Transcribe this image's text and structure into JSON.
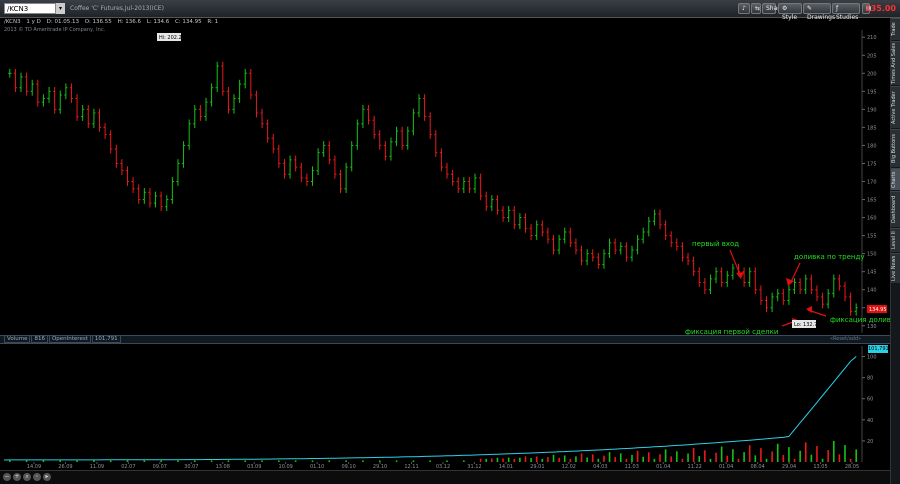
{
  "toolbar": {
    "symbol": "/KCN3",
    "contract_description": "Coffee 'C' Futures,Jul-2013(ICE)",
    "share_label": "Share",
    "style_label": "Style",
    "drawings_label": "Drawings",
    "studies_label": "Studies",
    "last_price": "135.00"
  },
  "infobar": {
    "symbol": "/KCN3",
    "agg": "1 y D",
    "date": "D: 01.05.13",
    "open": "O: 136.55",
    "high": "H: 136.6",
    "low": "L: 134.6",
    "close": "C: 134.95",
    "flag": "R: 1"
  },
  "copyright": "2013 © TD Ameritrade IP Company, Inc.",
  "right_tabs": [
    "Trade",
    "Times And Sales",
    "Active Trader",
    "Big Buttons",
    "Charts",
    "Dashboard",
    "Level II",
    "Live News"
  ],
  "volume_legend": {
    "volume": "Volume",
    "volume_value": "816",
    "open_interest": "OpenInterest",
    "oi_value": "101,791"
  },
  "expand_label": "«Reset/add»",
  "oi_badge": "101,791",
  "chart_data": {
    "type": "candlestick",
    "title": "",
    "price_axis": {
      "ylim": [
        128,
        212
      ],
      "ticks": [
        130,
        135,
        140,
        145,
        150,
        155,
        160,
        165,
        170,
        175,
        180,
        185,
        190,
        195,
        200,
        205,
        210
      ]
    },
    "price_points": [
      [
        0,
        200
      ],
      [
        1,
        196
      ],
      [
        2,
        199
      ],
      [
        3,
        195
      ],
      [
        4,
        197
      ],
      [
        5,
        192
      ],
      [
        6,
        193
      ],
      [
        7,
        195
      ],
      [
        8,
        190
      ],
      [
        9,
        194
      ],
      [
        10,
        196
      ],
      [
        11,
        193
      ],
      [
        12,
        188
      ],
      [
        13,
        190
      ],
      [
        14,
        186
      ],
      [
        15,
        189
      ],
      [
        16,
        185
      ],
      [
        17,
        183
      ],
      [
        18,
        179
      ],
      [
        19,
        175
      ],
      [
        20,
        173
      ],
      [
        21,
        170
      ],
      [
        22,
        168
      ],
      [
        23,
        165
      ],
      [
        24,
        167
      ],
      [
        25,
        164
      ],
      [
        26,
        166
      ],
      [
        27,
        163
      ],
      [
        28,
        165
      ],
      [
        29,
        170
      ],
      [
        30,
        175
      ],
      [
        31,
        180
      ],
      [
        32,
        186
      ],
      [
        33,
        190
      ],
      [
        34,
        188
      ],
      [
        35,
        192
      ],
      [
        36,
        196
      ],
      [
        37,
        202
      ],
      [
        38,
        195
      ],
      [
        39,
        190
      ],
      [
        40,
        193
      ],
      [
        41,
        197
      ],
      [
        42,
        200
      ],
      [
        43,
        194
      ],
      [
        44,
        189
      ],
      [
        45,
        186
      ],
      [
        46,
        182
      ],
      [
        47,
        179
      ],
      [
        48,
        175
      ],
      [
        49,
        172
      ],
      [
        50,
        176
      ],
      [
        51,
        174
      ],
      [
        52,
        171
      ],
      [
        53,
        170
      ],
      [
        54,
        173
      ],
      [
        55,
        178
      ],
      [
        56,
        180
      ],
      [
        57,
        176
      ],
      [
        58,
        172
      ],
      [
        59,
        168
      ],
      [
        60,
        174
      ],
      [
        61,
        180
      ],
      [
        62,
        186
      ],
      [
        63,
        190
      ],
      [
        64,
        187
      ],
      [
        65,
        183
      ],
      [
        66,
        180
      ],
      [
        67,
        177
      ],
      [
        68,
        181
      ],
      [
        69,
        184
      ],
      [
        70,
        180
      ],
      [
        71,
        184
      ],
      [
        72,
        189
      ],
      [
        73,
        193
      ],
      [
        74,
        188
      ],
      [
        75,
        183
      ],
      [
        76,
        178
      ],
      [
        77,
        174
      ],
      [
        78,
        172
      ],
      [
        79,
        170
      ],
      [
        80,
        168
      ],
      [
        81,
        170
      ],
      [
        82,
        168
      ],
      [
        83,
        171
      ],
      [
        84,
        166
      ],
      [
        85,
        163
      ],
      [
        86,
        165
      ],
      [
        87,
        162
      ],
      [
        88,
        160
      ],
      [
        89,
        162
      ],
      [
        90,
        158
      ],
      [
        91,
        160
      ],
      [
        92,
        157
      ],
      [
        93,
        155
      ],
      [
        94,
        158
      ],
      [
        95,
        156
      ],
      [
        96,
        154
      ],
      [
        97,
        151
      ],
      [
        98,
        154
      ],
      [
        99,
        156
      ],
      [
        100,
        153
      ],
      [
        101,
        151
      ],
      [
        102,
        148
      ],
      [
        103,
        150
      ],
      [
        104,
        149
      ],
      [
        105,
        147
      ],
      [
        106,
        150
      ],
      [
        107,
        153
      ],
      [
        108,
        151
      ],
      [
        109,
        152
      ],
      [
        110,
        149
      ],
      [
        111,
        151
      ],
      [
        112,
        154
      ],
      [
        113,
        156
      ],
      [
        114,
        159
      ],
      [
        115,
        161
      ],
      [
        116,
        158
      ],
      [
        117,
        155
      ],
      [
        118,
        153
      ],
      [
        119,
        152
      ],
      [
        120,
        149
      ],
      [
        121,
        148
      ],
      [
        122,
        145
      ],
      [
        123,
        142
      ],
      [
        124,
        140
      ],
      [
        125,
        143
      ],
      [
        126,
        145
      ],
      [
        127,
        142
      ],
      [
        128,
        144
      ],
      [
        129,
        146
      ],
      [
        130,
        145
      ],
      [
        131,
        142
      ],
      [
        132,
        145
      ],
      [
        133,
        140
      ],
      [
        134,
        137
      ],
      [
        135,
        135
      ],
      [
        136,
        138
      ],
      [
        137,
        139
      ],
      [
        138,
        137
      ],
      [
        139,
        140
      ],
      [
        140,
        142
      ],
      [
        141,
        140
      ],
      [
        142,
        143
      ],
      [
        143,
        140
      ],
      [
        144,
        138
      ],
      [
        145,
        136
      ],
      [
        146,
        139
      ],
      [
        147,
        143
      ],
      [
        148,
        141
      ],
      [
        149,
        138
      ],
      [
        150,
        134
      ],
      [
        151,
        135
      ]
    ],
    "volume_axis": {
      "ylim": [
        0,
        110
      ],
      "ticks": [
        20,
        40,
        60,
        80,
        100
      ]
    },
    "x_ticks": [
      "14.09",
      "26.09",
      "11.09",
      "02.07",
      "09.07",
      "30.07",
      "13.08",
      "03.09",
      "10.09",
      "01.10",
      "09.10",
      "29.10",
      "12.11",
      "03.12",
      "31.12",
      "14.01",
      "29.01",
      "12.02",
      "04.03",
      "11.03",
      "01.04",
      "11.22",
      "01.04",
      "08.04",
      "29.04",
      "13.05",
      "28.05"
    ],
    "hi_label": "Hi: 202.2",
    "lo_label": "Lo: 132.7",
    "current_price_label": "134.95",
    "annotations": [
      {
        "text": "первый вход",
        "color": "#22dd22"
      },
      {
        "text": "доливка по тренду",
        "color": "#22dd22"
      },
      {
        "text": "фиксация доливки",
        "color": "#22dd22"
      },
      {
        "text": "фиксация первой сделки",
        "color": "#22dd22"
      }
    ]
  }
}
